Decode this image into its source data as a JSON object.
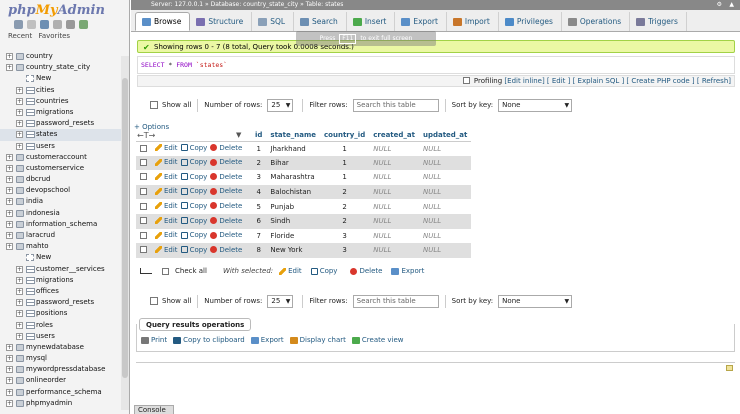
{
  "sidebar": {
    "logo": {
      "php": "php",
      "my": "My",
      "admin": "Admin"
    },
    "tabs": [
      "Recent",
      "Favorites"
    ],
    "tree": [
      {
        "label": "country",
        "level": 0,
        "type": "db"
      },
      {
        "label": "country_state_city",
        "level": 0,
        "type": "db"
      },
      {
        "label": "New",
        "level": 1,
        "type": "new"
      },
      {
        "label": "cities",
        "level": 1,
        "type": "table"
      },
      {
        "label": "countries",
        "level": 1,
        "type": "table"
      },
      {
        "label": "migrations",
        "level": 1,
        "type": "table"
      },
      {
        "label": "password_resets",
        "level": 1,
        "type": "table"
      },
      {
        "label": "states",
        "level": 1,
        "type": "table",
        "selected": true
      },
      {
        "label": "users",
        "level": 1,
        "type": "table"
      },
      {
        "label": "customeraccount",
        "level": 0,
        "type": "db"
      },
      {
        "label": "customerservice",
        "level": 0,
        "type": "db"
      },
      {
        "label": "dbcrud",
        "level": 0,
        "type": "db"
      },
      {
        "label": "devopschool",
        "level": 0,
        "type": "db"
      },
      {
        "label": "india",
        "level": 0,
        "type": "db"
      },
      {
        "label": "indonesia",
        "level": 0,
        "type": "db"
      },
      {
        "label": "information_schema",
        "level": 0,
        "type": "db"
      },
      {
        "label": "laracrud",
        "level": 0,
        "type": "db"
      },
      {
        "label": "mahto",
        "level": 0,
        "type": "db"
      },
      {
        "label": "New",
        "level": 1,
        "type": "new"
      },
      {
        "label": "customer__services",
        "level": 1,
        "type": "table"
      },
      {
        "label": "migrations",
        "level": 1,
        "type": "table"
      },
      {
        "label": "offices",
        "level": 1,
        "type": "table"
      },
      {
        "label": "password_resets",
        "level": 1,
        "type": "table"
      },
      {
        "label": "positions",
        "level": 1,
        "type": "table"
      },
      {
        "label": "roles",
        "level": 1,
        "type": "table"
      },
      {
        "label": "users",
        "level": 1,
        "type": "table"
      },
      {
        "label": "mynewdatabase",
        "level": 0,
        "type": "db"
      },
      {
        "label": "mysql",
        "level": 0,
        "type": "db"
      },
      {
        "label": "mywordpressdatabase",
        "level": 0,
        "type": "db"
      },
      {
        "label": "onlineorder",
        "level": 0,
        "type": "db"
      },
      {
        "label": "performance_schema",
        "level": 0,
        "type": "db"
      },
      {
        "label": "phpmyadmin",
        "level": 0,
        "type": "db"
      }
    ]
  },
  "breadcrumb": "Server: 127.0.0.1 » Database: country_state_city » Table: states",
  "tabs": [
    {
      "label": "Browse",
      "active": true,
      "color": "#5a8fc8"
    },
    {
      "label": "Structure",
      "color": "#7a6fb0"
    },
    {
      "label": "SQL",
      "color": "#8aa0b8"
    },
    {
      "label": "Search",
      "color": "#6d8fb3"
    },
    {
      "label": "Insert",
      "color": "#4caa4c"
    },
    {
      "label": "Export",
      "color": "#5a8fc8"
    },
    {
      "label": "Import",
      "color": "#c8762a"
    },
    {
      "label": "Privileges",
      "color": "#4c8ac8"
    },
    {
      "label": "Operations",
      "color": "#8a8a8a"
    },
    {
      "label": "Triggers",
      "color": "#7a7a9a"
    }
  ],
  "success_message": "Showing rows 0 - 7 (8 total, Query took 0.0008 seconds.)",
  "fullscreen_hint": {
    "prefix": "Press",
    "key": "F11",
    "suffix": "to exit full screen"
  },
  "sql": {
    "kw1": "SELECT",
    "star": " * ",
    "kw2": "FROM",
    "table": " `states`"
  },
  "profiling": {
    "label": "Profiling",
    "links": "[Edit inline] [ Edit ] [ Explain SQL ] [ Create PHP code ] [ Refresh]"
  },
  "nav": {
    "show_all": "Show all",
    "num_rows_label": "Number of rows:",
    "num_rows_value": "25",
    "filter_label": "Filter rows:",
    "filter_placeholder": "Search this table",
    "sort_label": "Sort by key:",
    "sort_value": "None"
  },
  "options_link": "+ Options",
  "columns": [
    "id",
    "state_name",
    "country_id",
    "created_at",
    "updated_at"
  ],
  "actions": {
    "edit": "Edit",
    "copy": "Copy",
    "delete": "Delete"
  },
  "rows": [
    {
      "id": "1",
      "state_name": "Jharkhand",
      "country_id": "1",
      "created_at": "NULL",
      "updated_at": "NULL"
    },
    {
      "id": "2",
      "state_name": "Bihar",
      "country_id": "1",
      "created_at": "NULL",
      "updated_at": "NULL"
    },
    {
      "id": "3",
      "state_name": "Maharashtra",
      "country_id": "1",
      "created_at": "NULL",
      "updated_at": "NULL"
    },
    {
      "id": "4",
      "state_name": "Balochistan",
      "country_id": "2",
      "created_at": "NULL",
      "updated_at": "NULL"
    },
    {
      "id": "5",
      "state_name": "Punjab",
      "country_id": "2",
      "created_at": "NULL",
      "updated_at": "NULL"
    },
    {
      "id": "6",
      "state_name": "Sindh",
      "country_id": "2",
      "created_at": "NULL",
      "updated_at": "NULL"
    },
    {
      "id": "7",
      "state_name": "Floride",
      "country_id": "3",
      "created_at": "NULL",
      "updated_at": "NULL"
    },
    {
      "id": "8",
      "state_name": "New York",
      "country_id": "3",
      "created_at": "NULL",
      "updated_at": "NULL"
    }
  ],
  "with_selected": {
    "check_all": "Check all",
    "label": "With selected:",
    "edit": "Edit",
    "copy": "Copy",
    "delete": "Delete",
    "export": "Export"
  },
  "qro": {
    "title": "Query results operations",
    "links": [
      {
        "label": "Print",
        "color": "#777"
      },
      {
        "label": "Copy to clipboard",
        "color": "#235a81"
      },
      {
        "label": "Export",
        "color": "#5a8fc8"
      },
      {
        "label": "Display chart",
        "color": "#d48a1c"
      },
      {
        "label": "Create view",
        "color": "#4caa4c"
      }
    ]
  },
  "console_label": "Console"
}
